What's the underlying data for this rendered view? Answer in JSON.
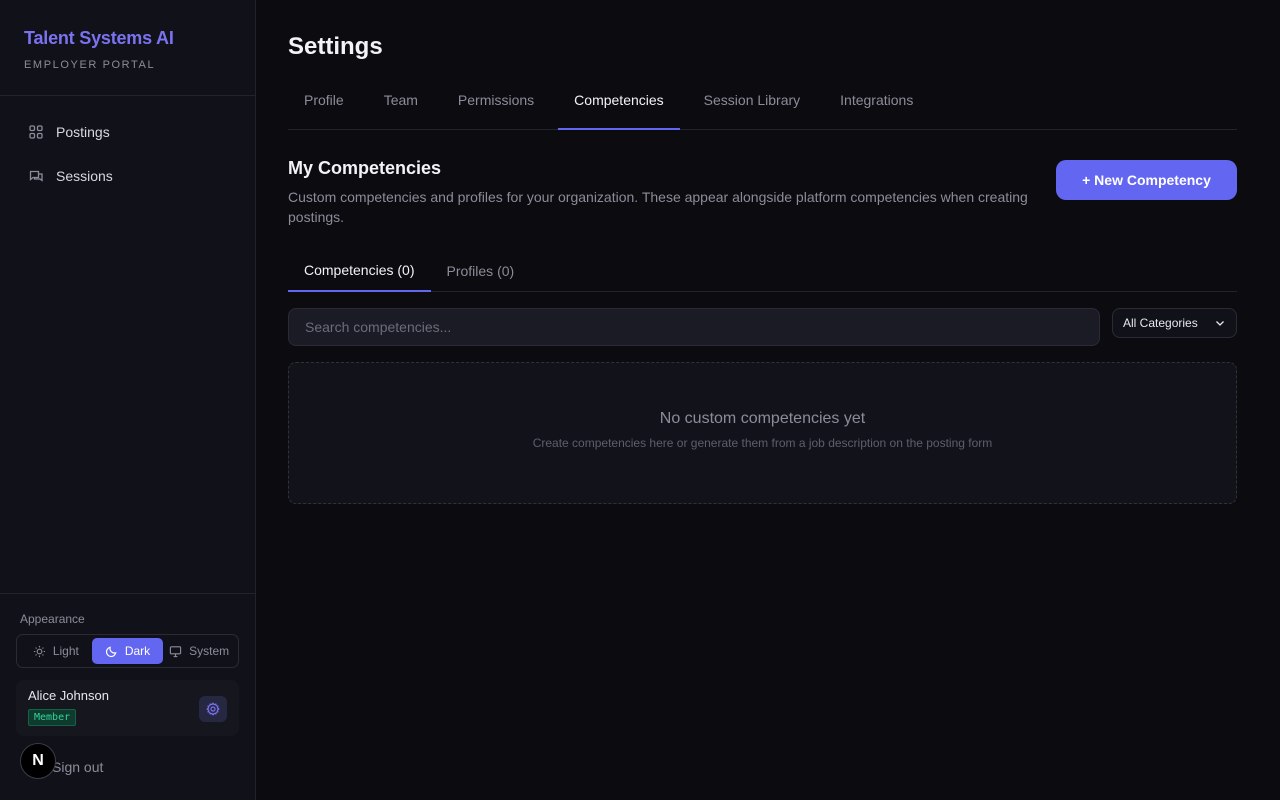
{
  "sidebar": {
    "brand_title": "Talent Systems AI",
    "brand_subtitle": "EMPLOYER PORTAL",
    "nav": [
      {
        "label": "Postings",
        "icon": "grid-icon"
      },
      {
        "label": "Sessions",
        "icon": "chat-icon"
      }
    ],
    "appearance_label": "Appearance",
    "theme_options": [
      {
        "label": "Light",
        "icon": "sun-icon",
        "active": false
      },
      {
        "label": "Dark",
        "icon": "moon-icon",
        "active": true
      },
      {
        "label": "System",
        "icon": "monitor-icon",
        "active": false
      }
    ],
    "user": {
      "name": "Alice Johnson",
      "role": "Member"
    },
    "signout_label": "Sign out",
    "n_badge": "N"
  },
  "page": {
    "title": "Settings",
    "tabs": [
      {
        "label": "Profile",
        "active": false
      },
      {
        "label": "Team",
        "active": false
      },
      {
        "label": "Permissions",
        "active": false
      },
      {
        "label": "Competencies",
        "active": true
      },
      {
        "label": "Session Library",
        "active": false
      },
      {
        "label": "Integrations",
        "active": false
      }
    ],
    "section_title": "My Competencies",
    "section_desc": "Custom competencies and profiles for your organization. These appear alongside platform competencies when creating postings.",
    "new_button": "+ New Competency",
    "subtabs": [
      {
        "label": "Competencies (0)",
        "active": true
      },
      {
        "label": "Profiles (0)",
        "active": false
      }
    ],
    "search": {
      "placeholder": "Search competencies...",
      "value": ""
    },
    "category_filter": "All Categories",
    "empty_title": "No custom competencies yet",
    "empty_subtitle": "Create competencies here or generate them from a job description on the posting form"
  },
  "colors": {
    "accent": "#6366f1",
    "brand": "#7b72f0",
    "background": "#0b0b10",
    "sidebar": "#111219",
    "badge_green": "#34d399"
  }
}
